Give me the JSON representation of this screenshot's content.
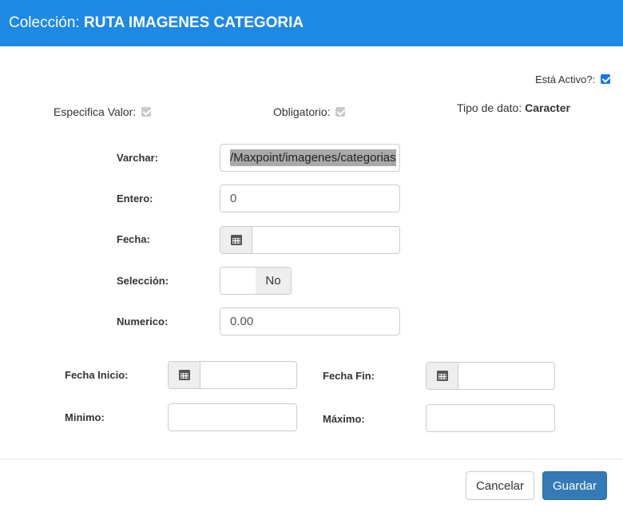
{
  "header": {
    "prefix": "Colección:",
    "name": "RUTA IMAGENES CATEGORIA",
    "bg_color": "#1e88e5"
  },
  "status": {
    "activo_label": "Está Activo?:",
    "activo_checked": true,
    "especifica_label": "Especifica Valor:",
    "especifica_checked": true,
    "obligatorio_label": "Obligatorio:",
    "obligatorio_checked": true,
    "tipo_label": "Tipo de dato:",
    "tipo_value": "Caracter"
  },
  "fields": {
    "varchar_label": "Varchar:",
    "varchar_value": "/Maxpoint/imagenes/categorias",
    "entero_label": "Entero:",
    "entero_value": "0",
    "fecha_label": "Fecha:",
    "fecha_value": "",
    "seleccion_label": "Selección:",
    "seleccion_value": "No",
    "numerico_label": "Numerico:",
    "numerico_value": "0.00",
    "fecha_inicio_label": "Fecha Inicio:",
    "fecha_fin_label": "Fecha Fin:",
    "minimo_label": "Minimo:",
    "maximo_label": "Máximo:"
  },
  "footer": {
    "cancel_label": "Cancelar",
    "save_label": "Guardar",
    "save_color": "#337ab7"
  },
  "icons": {
    "calendar": "calendar-icon",
    "checkbox": "checkbox-check-icon"
  }
}
